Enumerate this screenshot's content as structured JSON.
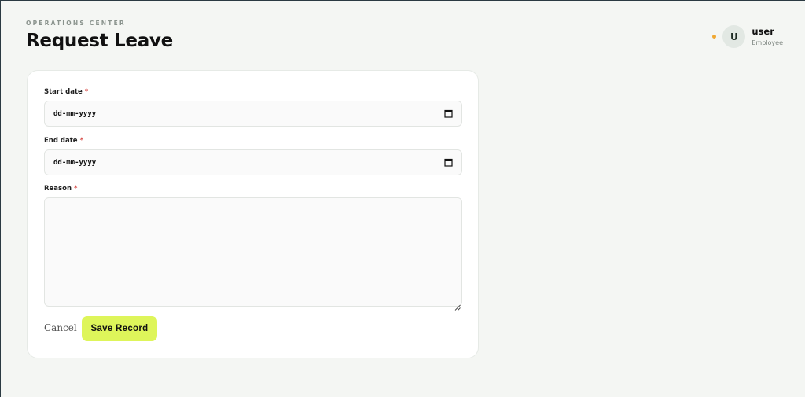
{
  "header": {
    "eyebrow": "OPERATIONS CENTER",
    "title": "Request Leave"
  },
  "user": {
    "initial": "U",
    "name": "user",
    "role": "Employee",
    "status_color": "#f0a832"
  },
  "form": {
    "start_date": {
      "label": "Start date",
      "required_mark": "*",
      "value": "dd-mm-yyyy",
      "icon": "calendar-icon"
    },
    "end_date": {
      "label": "End date",
      "required_mark": "*",
      "value": "dd-mm-yyyy",
      "icon": "calendar-icon"
    },
    "reason": {
      "label": "Reason",
      "required_mark": "*",
      "value": ""
    }
  },
  "actions": {
    "cancel_label": "Cancel",
    "save_label": "Save Record",
    "save_color": "#def55a"
  }
}
